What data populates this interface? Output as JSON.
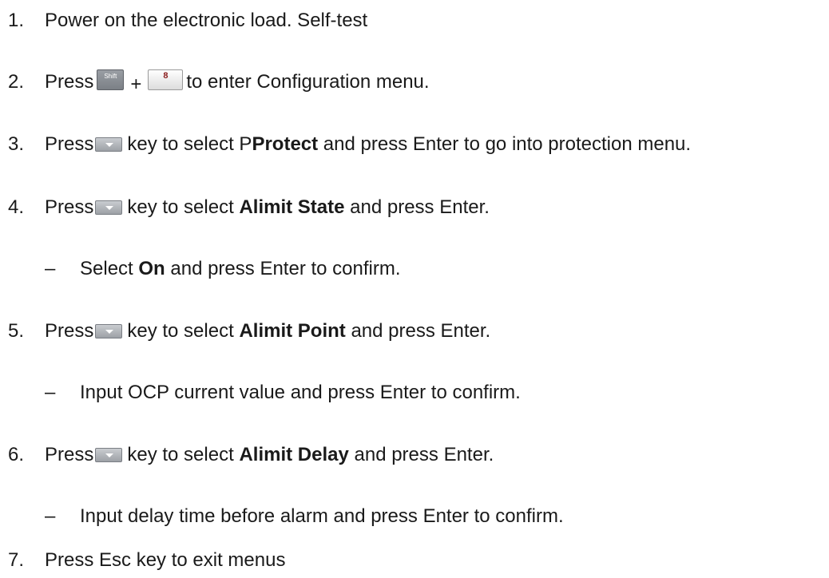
{
  "steps": {
    "s1": {
      "num": "1.",
      "text": "Power on the electronic load. Self-test"
    },
    "s2": {
      "num": "2.",
      "pre": "Press",
      "shift_label": "Shift",
      "plus": "+",
      "eight_label": "8",
      "post": "to enter Configuration menu."
    },
    "s3": {
      "num": "3.",
      "pre": "Press",
      "mid": "key to select P",
      "bold": "Protect",
      "post": "and press Enter to go into protection menu."
    },
    "s4": {
      "num": "4.",
      "pre": "Press",
      "mid": "key to select",
      "bold": "Alimit State",
      "post": "and press Enter."
    },
    "s4a": {
      "dash": "–",
      "pre": "Select",
      "bold": "On",
      "post": "and press Enter to confirm."
    },
    "s5": {
      "num": "5.",
      "pre": "Press",
      "mid": "key to select",
      "bold": "Alimit Point",
      "post": "and press Enter."
    },
    "s5a": {
      "dash": "–",
      "text": "Input OCP current value and press Enter to confirm."
    },
    "s6": {
      "num": "6.",
      "pre": "Press",
      "mid": "key to select",
      "bold": "Alimit Delay",
      "post": "and press Enter."
    },
    "s6a": {
      "dash": "–",
      "text": "Input delay time before alarm and press Enter to confirm."
    },
    "s7": {
      "num": "7.",
      "text": "Press Esc key to exit menus"
    }
  },
  "icons": {
    "shift_key": "shift-key-icon",
    "eight_key": "eight-key-icon",
    "down_key": "down-arrow-key-icon"
  }
}
